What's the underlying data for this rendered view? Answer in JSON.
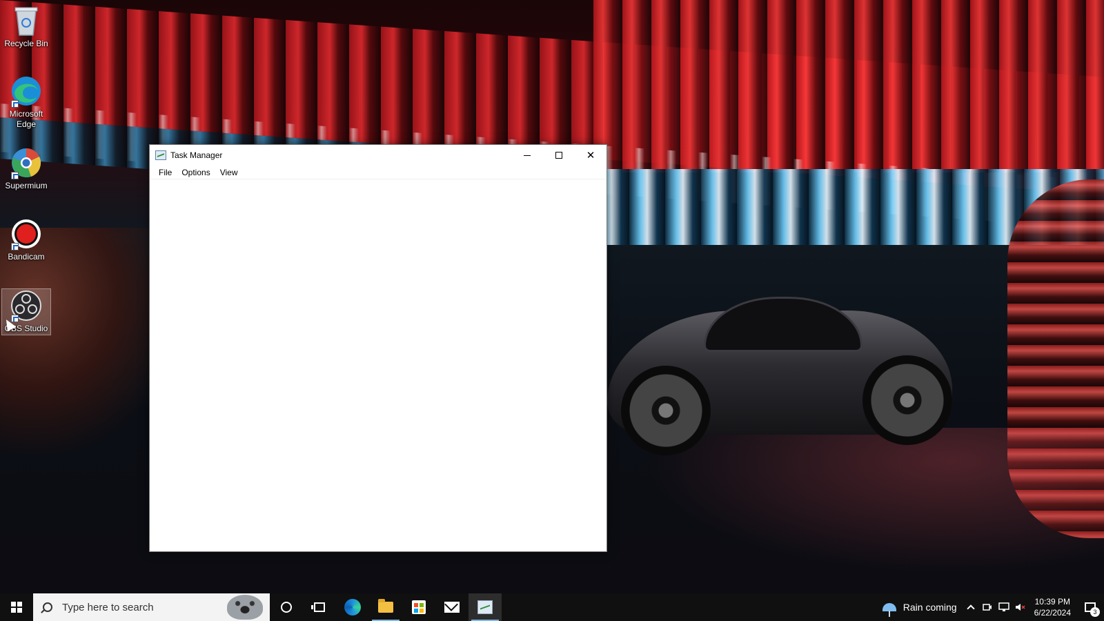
{
  "desktop": {
    "icons": [
      {
        "label": "Recycle Bin",
        "icon": "recycle-bin-icon"
      },
      {
        "label": "Microsoft Edge",
        "icon": "edge-icon"
      },
      {
        "label": "Supermium",
        "icon": "supermium-icon"
      },
      {
        "label": "Bandicam",
        "icon": "bandicam-icon"
      },
      {
        "label": "OBS Studio",
        "icon": "obs-icon"
      }
    ]
  },
  "window": {
    "title": "Task Manager",
    "icon": "task-manager-icon",
    "controls": {
      "minimize": "minimize-icon",
      "maximize": "maximize-icon",
      "close": "✕"
    },
    "menu": [
      {
        "label": "File"
      },
      {
        "label": "Options"
      },
      {
        "label": "View"
      }
    ]
  },
  "taskbar": {
    "search_placeholder": "Type here to search",
    "pinned": [
      "cortana-icon",
      "task-view-icon",
      "edge-icon",
      "file-explorer-icon",
      "store-icon",
      "mail-icon",
      "task-manager-icon"
    ],
    "active_app": "Task Manager",
    "weather": {
      "text": "Rain coming",
      "icon": "umbrella-icon"
    },
    "clock": {
      "time": "10:39 PM",
      "date": "6/22/2024"
    },
    "notifications_count": "3"
  },
  "colors": {
    "taskbar": "#101010",
    "accent": "#76b9ed",
    "window_bg": "#ffffff"
  }
}
